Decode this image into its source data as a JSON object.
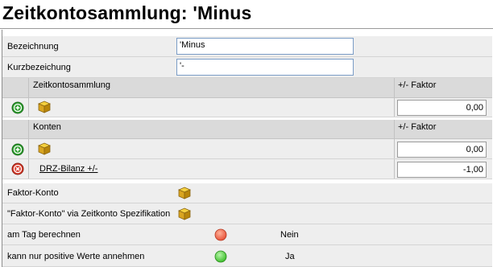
{
  "title": "Zeitkontosammlung: 'Minus",
  "fields": {
    "bezeichnung": {
      "label": "Bezeichnung",
      "value": "'Minus"
    },
    "kurzbezeichnung": {
      "label": "Kurzbezeichung",
      "value": "'-"
    }
  },
  "zeitkonto_table": {
    "header_name": "Zeitkontosammlung",
    "header_factor": "+/- Faktor",
    "new_row_factor": "0,00"
  },
  "konten_table": {
    "header_name": "Konten",
    "header_factor": "+/- Faktor",
    "new_row_factor": "0,00",
    "rows": [
      {
        "name": "DRZ-Bilanz +/-",
        "factor": "-1,00"
      }
    ]
  },
  "faktor_konto": {
    "label": "Faktor-Konto"
  },
  "faktor_konto_spez": {
    "label": "\"Faktor-Konto\" via Zeitkonto Spezifikation"
  },
  "am_tag_berechnen": {
    "label": "am Tag berechnen",
    "value": "Nein",
    "status_color": "#e8533a"
  },
  "nur_positive": {
    "label": "kann nur positive Werte annehmen",
    "value": "Ja",
    "status_color": "#3fbf2e"
  },
  "colors": {
    "add_green": "#2e9e2e",
    "delete_red": "#d83a2a",
    "box_gold": "#d9a520"
  },
  "icons": {
    "add": "add-circle-icon",
    "delete": "delete-circle-icon",
    "box": "box-icon",
    "status_red": "red-status-dot-icon",
    "status_green": "green-status-dot-icon"
  }
}
